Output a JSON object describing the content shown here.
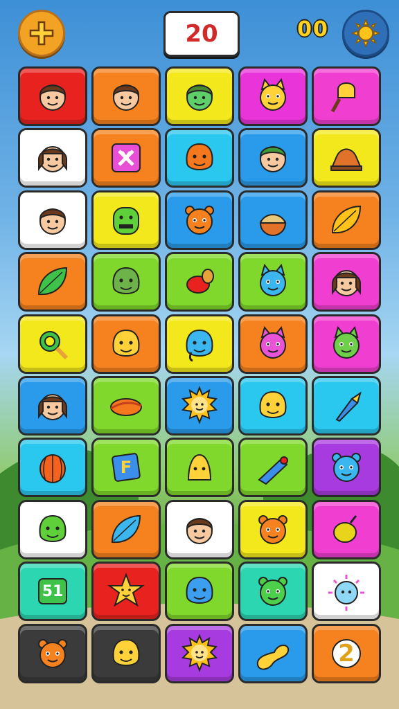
{
  "hud": {
    "score_text": "20",
    "moves_text": "00",
    "menu_icon": "cross-star-icon",
    "settings_icon": "sun-gear-icon"
  },
  "board": {
    "columns": 5,
    "rows": 10,
    "tiles": [
      {
        "color": "#e8231f",
        "icon": "boy-face-icon"
      },
      {
        "color": "#f5821e",
        "icon": "boy-face-icon"
      },
      {
        "color": "#f3e81b",
        "icon": "green-face-icon"
      },
      {
        "color": "#e934d9",
        "icon": "yellow-cat-icon"
      },
      {
        "color": "#f03fd0",
        "icon": "ice-cream-icon"
      },
      {
        "color": "#ffffff",
        "icon": "girl-face-icon"
      },
      {
        "color": "#f5821e",
        "icon": "close-box-icon",
        "text": "X"
      },
      {
        "color": "#2ac7ee",
        "icon": "orange-blob-icon"
      },
      {
        "color": "#2a9bea",
        "icon": "green-hair-boy-icon"
      },
      {
        "color": "#f3e81b",
        "icon": "shell-icon"
      },
      {
        "color": "#ffffff",
        "icon": "boy-face-icon"
      },
      {
        "color": "#f3e81b",
        "icon": "green-monster-icon"
      },
      {
        "color": "#2a9bea",
        "icon": "orange-bear-icon"
      },
      {
        "color": "#2a9bea",
        "icon": "acorn-icon"
      },
      {
        "color": "#f5821e",
        "icon": "leaf-icon"
      },
      {
        "color": "#f5821e",
        "icon": "green-leaf-icon"
      },
      {
        "color": "#7fd82b",
        "icon": "green-ogre-icon"
      },
      {
        "color": "#7fd82b",
        "icon": "red-fruit-icon"
      },
      {
        "color": "#7fd82b",
        "icon": "blue-cat-icon"
      },
      {
        "color": "#f03fd0",
        "icon": "girl-face-icon"
      },
      {
        "color": "#f3e81b",
        "icon": "magnifier-icon"
      },
      {
        "color": "#f5821e",
        "icon": "yellow-chick-icon"
      },
      {
        "color": "#f3e81b",
        "icon": "blue-elephant-icon"
      },
      {
        "color": "#f5821e",
        "icon": "pink-cat-icon"
      },
      {
        "color": "#f03fd0",
        "icon": "green-dragon-icon"
      },
      {
        "color": "#2a9bea",
        "icon": "girl-face-icon"
      },
      {
        "color": "#7fd82b",
        "icon": "planet-icon"
      },
      {
        "color": "#2a9bea",
        "icon": "sun-face-icon"
      },
      {
        "color": "#2ac7ee",
        "icon": "yellow-chick-icon"
      },
      {
        "color": "#2ac7ee",
        "icon": "rocket-icon"
      },
      {
        "color": "#2ac7ee",
        "icon": "orange-ball-icon"
      },
      {
        "color": "#7fd82b",
        "icon": "letter-f-icon",
        "text": "F"
      },
      {
        "color": "#7fd82b",
        "icon": "yellow-bell-icon"
      },
      {
        "color": "#7fd82b",
        "icon": "blue-top-icon"
      },
      {
        "color": "#a83be0",
        "icon": "blue-bear-icon"
      },
      {
        "color": "#ffffff",
        "icon": "green-bird-icon"
      },
      {
        "color": "#f5821e",
        "icon": "blue-leaf-icon"
      },
      {
        "color": "#ffffff",
        "icon": "boy-face-icon"
      },
      {
        "color": "#f3e81b",
        "icon": "orange-bear-icon"
      },
      {
        "color": "#f03fd0",
        "icon": "lemon-icon"
      },
      {
        "color": "#2cd6b0",
        "icon": "number-block-icon",
        "text": "51"
      },
      {
        "color": "#e8231f",
        "icon": "yellow-star-face-icon"
      },
      {
        "color": "#7fd82b",
        "icon": "blue-blob-icon"
      },
      {
        "color": "#2cd6b0",
        "icon": "green-frog-icon"
      },
      {
        "color": "#ffffff",
        "icon": "blue-virus-icon"
      },
      {
        "color": "#3b3b3b",
        "icon": "orange-bear-icon"
      },
      {
        "color": "#3b3b3b",
        "icon": "yellow-blob-icon"
      },
      {
        "color": "#a83be0",
        "icon": "sun-face-icon"
      },
      {
        "color": "#2a9bea",
        "icon": "yellow-peanut-icon"
      },
      {
        "color": "#f5821e",
        "icon": "number-two-icon",
        "text": "2"
      }
    ]
  }
}
